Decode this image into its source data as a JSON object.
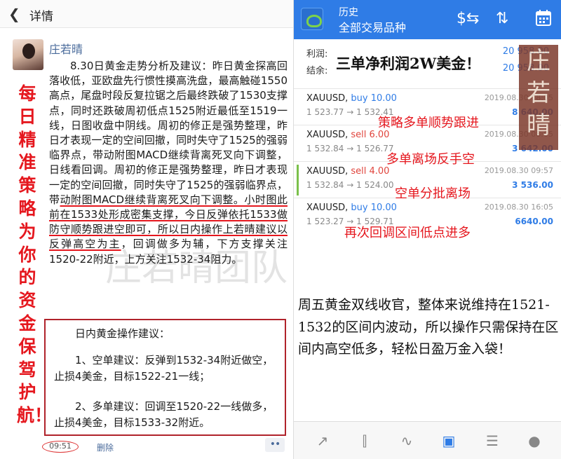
{
  "left": {
    "header_title": "详情",
    "author": "庄若晴",
    "vertical_slogan": "每日精准策略为你的资金保驾护航！",
    "analysis_part1": "8.30日黄金走势分析及建议：昨日黄金探高回落收低，亚欧盘先行惯性摸高洗盘，最高触碰1550高点，尾盘时段反复拉锯之后最终跌破了1530支撑点，同时还跌破周初低点1525附近最低至1519一线，日图收盘中阴线。周初的修正是强势整理，昨日才表现一定的空间回撤，同时失守了1525的强弱临界点，带动附图MACD继续背离死叉向下调整，日线看回调。周初的修正是强势整理，昨日才表现一定的空间回撤，同时失守了1525的强弱临界点，带",
    "analysis_underlined": "动附图MACD继续背离死叉向下调整。小时图此前在1533处形成密集支撑，今日反弹依托1533做防守顺势跟进空即可，所以日内操作上若晴建议以反弹高空为主",
    "analysis_part2": "，回调做多为辅，下方支撑关注1520-22附近，上方关注1532-34阻力。",
    "advice_title": "日内黄金操作建议：",
    "advice_short": "1、空单建议：反弹到1532-34附近做空，止损4美金，目标1522-21一线；",
    "advice_long": "2、多单建议：回调至1520-22一线做多，止损4美金，目标1533-32附近。",
    "time": "09:51",
    "delete_label": "删除",
    "more_label": "••",
    "watermark": "庄若晴团队"
  },
  "right": {
    "header_line1": "历史",
    "header_line2": "全部交易品种",
    "summary": [
      {
        "label": "利润:",
        "value": "20 958.00"
      },
      {
        "label": "结余:",
        "value": "20 958.00"
      }
    ],
    "trades": [
      {
        "symbol": "XAUUSD,",
        "side": "buy 10.00",
        "prices": "1 523.77 → 1 532.41",
        "date": "2019.08.30 08:05",
        "pnl": "8 640.00",
        "marked": false
      },
      {
        "symbol": "XAUUSD,",
        "side": "sell 6.00",
        "prices": "1 532.84 → 1 526.77",
        "date": "2019.08.30 08:05",
        "pnl": "3 642.00",
        "marked": false
      },
      {
        "symbol": "XAUUSD,",
        "side": "sell 4.00",
        "prices": "1 532.84 → 1 524.00",
        "date": "2019.08.30 09:57",
        "pnl": "3 536.00",
        "marked": true
      },
      {
        "symbol": "XAUUSD,",
        "side": "buy 10.00",
        "prices": "1 523.27 → 1 529.71",
        "date": "2019.08.30 16:05",
        "pnl": "6640.00",
        "marked": false
      }
    ],
    "annotation_top": "三单净利润2W美金！",
    "annotations": [
      "策略多单顺势跟进",
      "多单离场反手空",
      "空单分批离场",
      "再次回调区间低点进多"
    ],
    "summary_text": "周五黄金双线收官，整体来说维持在1521-1532的区间内波动，所以操作只需保持在区间内高空低多，轻松日盈万金入袋！",
    "seal_text": "庄若晴",
    "colors": {
      "header_blue": "#2f7ce6",
      "annotation_red": "#e5171e"
    }
  }
}
